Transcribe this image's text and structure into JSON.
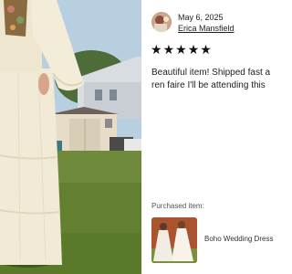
{
  "review": {
    "date": "May 6, 2025",
    "reviewer_name": "Erica Mansfield",
    "rating": 5,
    "stars": [
      "★",
      "★",
      "★",
      "★",
      "★"
    ],
    "text_line1": "Beautiful item! Shipped fast a",
    "text_line2": "ren faire I'll be attending this",
    "purchased_label": "Purchased item:",
    "item_title": "Boho Wedding Dress"
  },
  "colors": {
    "star": "#111111",
    "link": "#222222",
    "muted": "#555555"
  }
}
